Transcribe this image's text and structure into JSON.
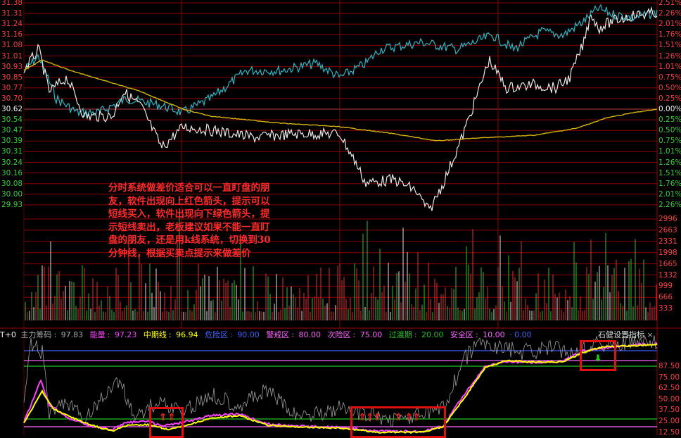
{
  "price_axis": {
    "left": [
      "31.38",
      "31.31",
      "31.24",
      "31.16",
      "31.08",
      "31.01",
      "30.93",
      "30.85",
      "30.77",
      "30.70",
      "30.62",
      "30.54",
      "30.47",
      "30.39",
      "30.31",
      "30.24",
      "30.16",
      "30.08",
      "30.00",
      "29.93"
    ],
    "right": [
      "2.51%",
      "2.26%",
      "2.01%",
      "1.76%",
      "1.51%",
      "1.26%",
      "1.01%",
      "0.75%",
      "0.50%",
      "0.25%",
      "0.00%",
      "0.25%",
      "0.50%",
      "0.75%",
      "1.01%",
      "1.26%",
      "1.51%",
      "1.76%",
      "2.01%",
      "2.26%"
    ],
    "reference_index": 10
  },
  "volume_axis": {
    "labels": [
      "2996",
      "2663",
      "2331",
      "1998",
      "1665",
      "1332",
      "999",
      "666",
      "333"
    ]
  },
  "indicator_axis": {
    "labels": [
      "87.50",
      "75.00",
      "62.50",
      "50.00",
      "37.50",
      "25.00",
      "12.50"
    ]
  },
  "status_bar": {
    "t_plus": "T+0",
    "main_label": "主力筹码",
    "main_value": "97.83",
    "energy_label": "能量",
    "energy_value": "97.23",
    "mid_label": "中期线",
    "mid_value": "96.94",
    "danger_label": "危险区",
    "danger_value": "90.00",
    "alert_label": "警戒区",
    "alert_value": "80.00",
    "risk_label": "次险区",
    "risk_value": "75.00",
    "transition_label": "过渡期",
    "transition_value": "20.00",
    "safe_label": "安全区",
    "safe_value": "10.00",
    "tail": "· 0.00",
    "indicator_button": "石健设置指标",
    "close_symbol": "×"
  },
  "annotation": {
    "text": "分时系统做差价适合可以一直盯盘的朋友，软件出现向上红色箭头，提示可以短线买入，软件出现向下绿色箭头，提示短线卖出，老板建议如果不能一直盯盘的朋友，还是用k线系统，切换到30分钟线，根据买卖点提示来做差价"
  },
  "signals": {
    "buy_groups": [
      {
        "arrows": [
          "⇑",
          "⇑"
        ]
      },
      {
        "arrows": [
          "⇑",
          "⇑",
          "⇑",
          "⇑",
          "⇑",
          "⇑"
        ]
      }
    ],
    "sell_groups": [
      {
        "arrows": [
          "⬇"
        ]
      }
    ]
  },
  "colors": {
    "price_line": "#e8e8e8",
    "index_line": "#27b8c8",
    "avg_line": "#d8b400",
    "grid_red": "#8a0000",
    "zone_blue": "#4060ff",
    "zone_pink": "#ff60ff",
    "zone_green": "#20c020",
    "energy_line": "#ffff00",
    "main_line": "#ff40ff"
  }
}
